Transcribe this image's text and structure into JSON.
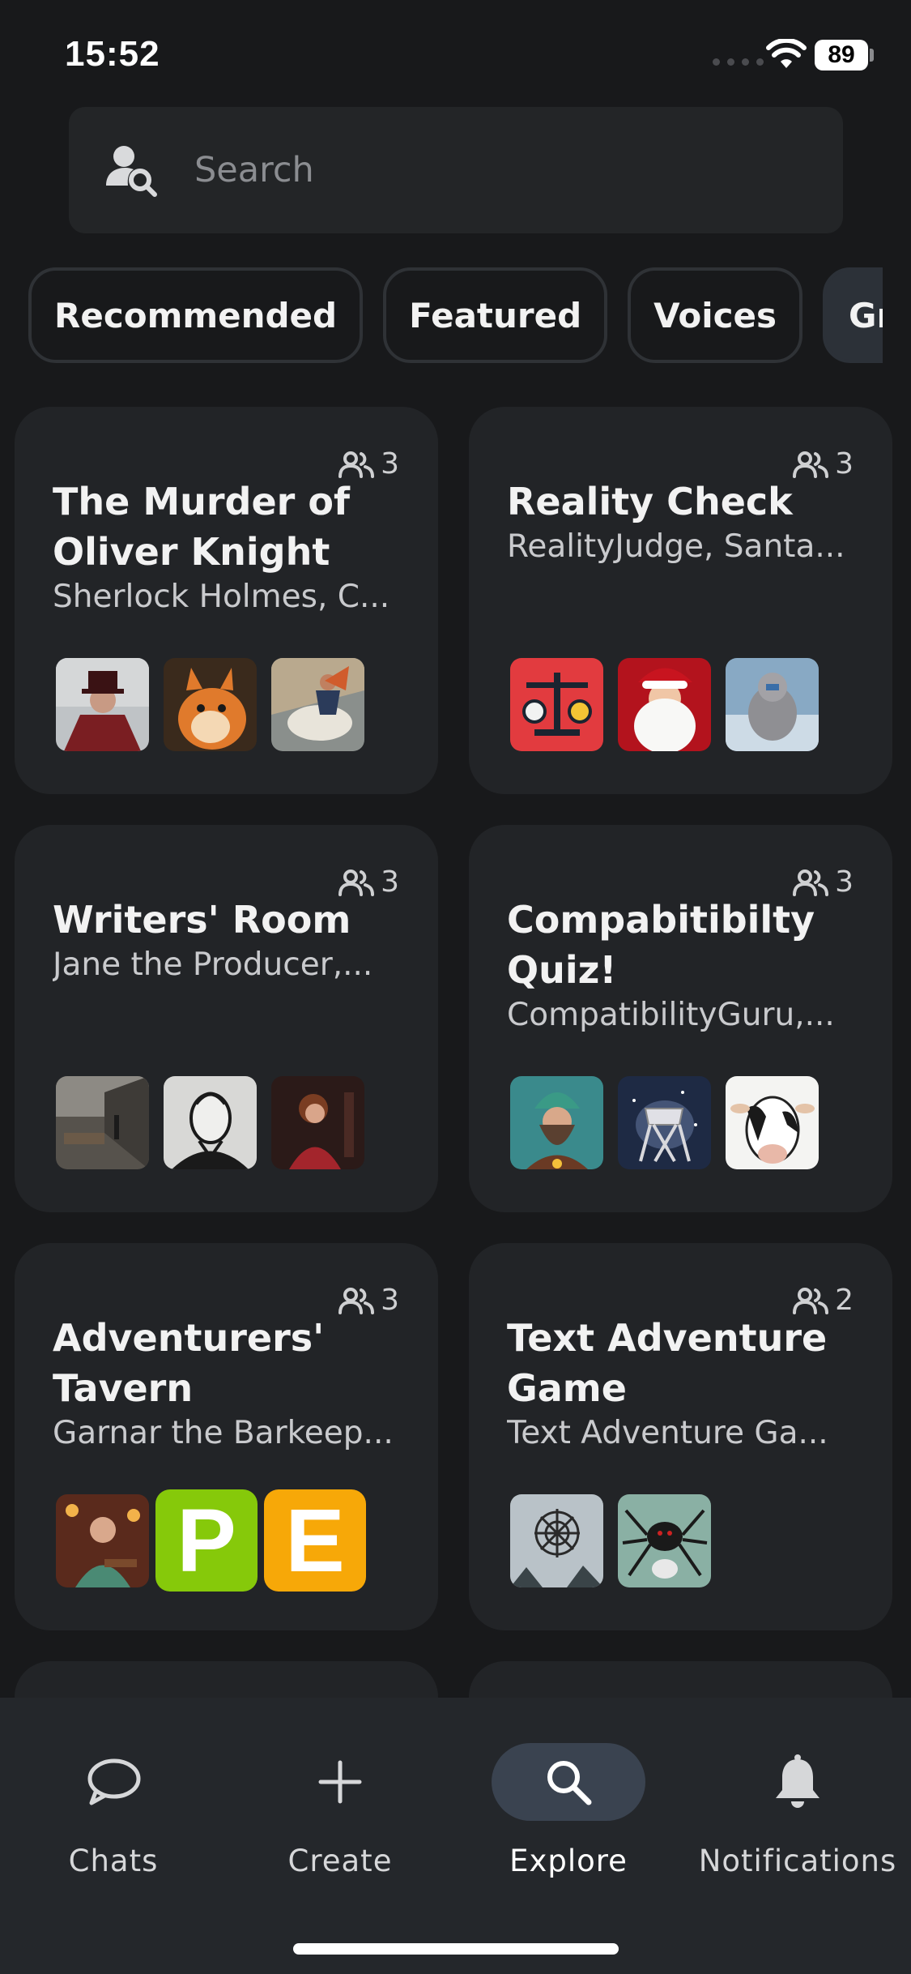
{
  "status_bar": {
    "time": "15:52",
    "battery": "89"
  },
  "search": {
    "placeholder": "Search"
  },
  "tabs": [
    {
      "label": "Recommended",
      "active": false
    },
    {
      "label": "Featured",
      "active": false
    },
    {
      "label": "Voices",
      "active": false
    },
    {
      "label": "Groups",
      "active": true
    }
  ],
  "cards": [
    {
      "title": "The Murder of\nOliver Knight",
      "subtitle": "Sherlock Holmes, C...",
      "count": "3"
    },
    {
      "title": "Reality Check",
      "subtitle": "RealityJudge, Santa...",
      "count": "3"
    },
    {
      "title": "Writers' Room",
      "subtitle": "Jane the Producer,...",
      "count": "3"
    },
    {
      "title": "Compabitibilty\nQuiz!",
      "subtitle": "CompatibilityGuru,...",
      "count": "3"
    },
    {
      "title": "Adventurers'\nTavern",
      "subtitle": "Garnar the Barkeep...",
      "count": "3",
      "letters": [
        "P",
        "E"
      ]
    },
    {
      "title": "Text Adventure\nGame",
      "subtitle": "Text Adventure Ga...",
      "count": "2"
    }
  ],
  "nav": [
    {
      "label": "Chats",
      "icon": "chat-bubble-icon"
    },
    {
      "label": "Create",
      "icon": "plus-icon"
    },
    {
      "label": "Explore",
      "icon": "magnifier-icon",
      "active": true
    },
    {
      "label": "Notifications",
      "icon": "bell-icon"
    }
  ]
}
